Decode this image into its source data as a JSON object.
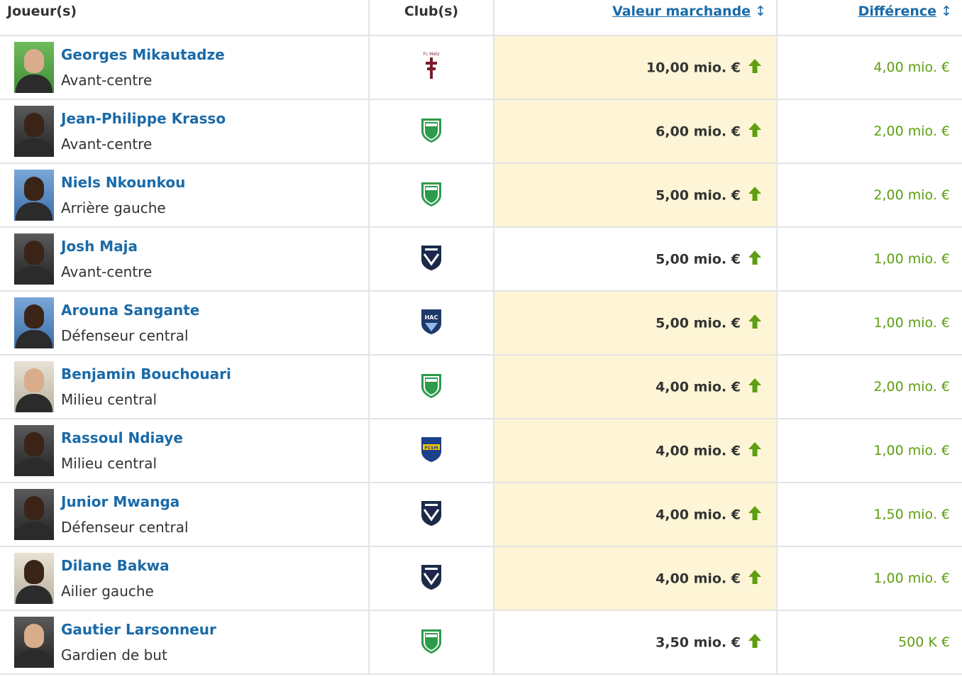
{
  "header": {
    "player_col": "Joueur(s)",
    "club_col": "Club(s)",
    "value_col": "Valeur marchande",
    "diff_col": "Différence",
    "sort_icon": "sort-arrows-icon"
  },
  "colors": {
    "link": "#1a6aa8",
    "highlight": "#fdf5d6",
    "positive": "#5e9e10",
    "text": "#333333"
  },
  "rows": [
    {
      "name": "Georges Mikautadze",
      "position": "Avant-centre",
      "club_crest": "fc-metz-crest-icon",
      "value": "10,00 mio. €",
      "trend": "up-arrow-icon",
      "diff": "4,00 mio. €",
      "highlight": true
    },
    {
      "name": "Jean-Philippe Krasso",
      "position": "Avant-centre",
      "club_crest": "as-saint-etienne-crest-icon",
      "value": "6,00 mio. €",
      "trend": "up-arrow-icon",
      "diff": "2,00 mio. €",
      "highlight": true
    },
    {
      "name": "Niels Nkounkou",
      "position": "Arrière gauche",
      "club_crest": "as-saint-etienne-crest-icon",
      "value": "5,00 mio. €",
      "trend": "up-arrow-icon",
      "diff": "2,00 mio. €",
      "highlight": true
    },
    {
      "name": "Josh Maja",
      "position": "Avant-centre",
      "club_crest": "girondins-bordeaux-crest-icon",
      "value": "5,00 mio. €",
      "trend": "up-arrow-icon",
      "diff": "1,00 mio. €",
      "highlight": false
    },
    {
      "name": "Arouna Sangante",
      "position": "Défenseur central",
      "club_crest": "le-havre-ac-crest-icon",
      "value": "5,00 mio. €",
      "trend": "up-arrow-icon",
      "diff": "1,00 mio. €",
      "highlight": true
    },
    {
      "name": "Benjamin Bouchouari",
      "position": "Milieu central",
      "club_crest": "as-saint-etienne-crest-icon",
      "value": "4,00 mio. €",
      "trend": "up-arrow-icon",
      "diff": "2,00 mio. €",
      "highlight": true
    },
    {
      "name": "Rassoul Ndiaye",
      "position": "Milieu central",
      "club_crest": "fc-sochaux-crest-icon",
      "value": "4,00 mio. €",
      "trend": "up-arrow-icon",
      "diff": "1,00 mio. €",
      "highlight": true
    },
    {
      "name": "Junior Mwanga",
      "position": "Défenseur central",
      "club_crest": "girondins-bordeaux-crest-icon",
      "value": "4,00 mio. €",
      "trend": "up-arrow-icon",
      "diff": "1,50 mio. €",
      "highlight": true
    },
    {
      "name": "Dilane Bakwa",
      "position": "Ailier gauche",
      "club_crest": "girondins-bordeaux-crest-icon",
      "value": "4,00 mio. €",
      "trend": "up-arrow-icon",
      "diff": "1,00 mio. €",
      "highlight": true
    },
    {
      "name": "Gautier Larsonneur",
      "position": "Gardien de but",
      "club_crest": "as-saint-etienne-crest-icon",
      "value": "3,50 mio. €",
      "trend": "up-arrow-icon",
      "diff": "500 K €",
      "highlight": false
    }
  ]
}
